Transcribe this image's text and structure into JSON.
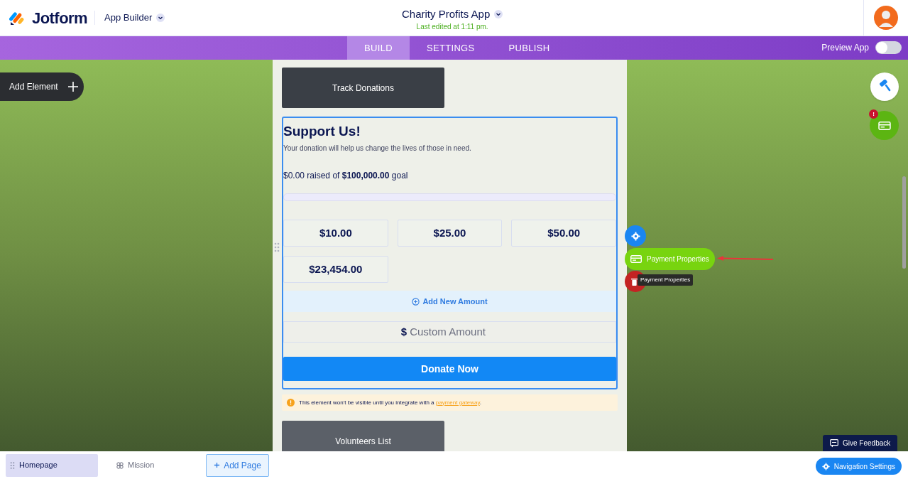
{
  "header": {
    "brand": "Jotform",
    "product": "App Builder",
    "app_title": "Charity Profits App",
    "last_edited": "Last edited at 1:11 pm."
  },
  "tabs": [
    {
      "label": "BUILD",
      "selected": true
    },
    {
      "label": "SETTINGS",
      "selected": false
    },
    {
      "label": "PUBLISH",
      "selected": false
    }
  ],
  "preview": {
    "label": "Preview App",
    "on": false
  },
  "add_element": "Add Element",
  "canvas": {
    "top_button": "Track Donations",
    "donation": {
      "title": "Support Us!",
      "description": "Your donation will help us change the lives of those in need.",
      "raised": "$0.00 raised of **$100,000.00** goal",
      "progress": {
        "level": 0
      },
      "amounts": [
        "$10.00",
        "$25.00",
        "$50.00",
        "$23,454.00"
      ],
      "add_amount": "Add New Amount",
      "custom": {
        "prefix": "$",
        "placeholder": "Custom Amount"
      },
      "donate": "Donate Now"
    },
    "warning": {
      "text": "This element won't be visible until you integrate with a",
      "link": "payment gateway",
      "suffix": "."
    },
    "bottom_button": "Volunteers List"
  },
  "element_menu": {
    "payment": "Payment Properties",
    "tooltip": "Payment Properties"
  },
  "right_badge": "!",
  "feedback": "Give Feedback",
  "pages": [
    {
      "label": "Homepage",
      "selected": true
    },
    {
      "label": "Mission",
      "selected": false
    }
  ],
  "add_page": "Add Page",
  "nav_settings": "Navigation Settings"
}
